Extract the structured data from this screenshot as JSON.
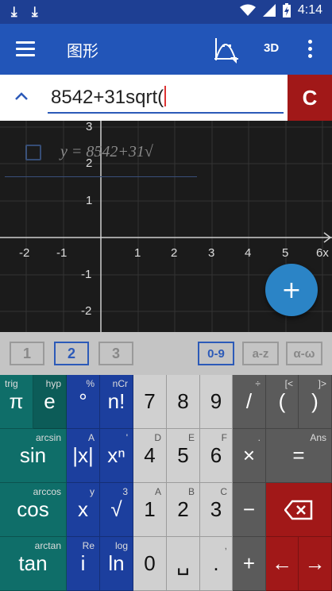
{
  "status_bar": {
    "time": "4:14"
  },
  "app_bar": {
    "title": "图形",
    "btn_3d": "3D"
  },
  "input": {
    "expression": "8542+31sqrt(",
    "clear_label": "C"
  },
  "graph": {
    "x_ticks": [
      "-2",
      "-1",
      "1",
      "2",
      "3",
      "4",
      "5",
      "6x"
    ],
    "y_ticks": [
      "3",
      "2",
      "1",
      "-1",
      "-2"
    ],
    "formula": "y = 8542+31√"
  },
  "keyboard_tabs": [
    "1",
    "2",
    "3",
    "0-9",
    "a-z",
    "α-ω"
  ],
  "keys": [
    {
      "main": "π",
      "sup": "trig"
    },
    {
      "main": "e",
      "sup": "hyp"
    },
    {
      "main": "°",
      "sup": "%"
    },
    {
      "main": "n!",
      "sup": "nCr"
    },
    {
      "main": "7",
      "sup": ""
    },
    {
      "main": "8",
      "sup": ""
    },
    {
      "main": "9",
      "sup": ""
    },
    {
      "main": "/",
      "sup": "÷"
    },
    {
      "main": "(",
      "sup": "[<"
    },
    {
      "main": ")",
      "sup": "]>"
    },
    {
      "main": "sin",
      "sup": "arcsin"
    },
    {
      "main": "|x|",
      "sup": "A"
    },
    {
      "main": "xⁿ",
      "sup": "'"
    },
    {
      "main": "4",
      "sup": "D"
    },
    {
      "main": "5",
      "sup": "E"
    },
    {
      "main": "6",
      "sup": "F"
    },
    {
      "main": "×",
      "sup": "."
    },
    {
      "main": "=",
      "sup": "Ans"
    },
    {
      "main": "cos",
      "sup": "arccos"
    },
    {
      "main": "x",
      "sup": "y"
    },
    {
      "main": "√",
      "sup": "3"
    },
    {
      "main": "1",
      "sup": "A"
    },
    {
      "main": "2",
      "sup": "B"
    },
    {
      "main": "3",
      "sup": "C"
    },
    {
      "main": "−",
      "sup": ""
    },
    {
      "main": "tan",
      "sup": "arctan"
    },
    {
      "main": "i",
      "sup": "Re"
    },
    {
      "main": "ln",
      "sup": "log"
    },
    {
      "main": "0",
      "sup": ""
    },
    {
      "main": "␣",
      "sup": ""
    },
    {
      "main": ".",
      "sup": ","
    },
    {
      "main": "+",
      "sup": ""
    },
    {
      "main": "←",
      "sup": ""
    },
    {
      "main": "→",
      "sup": ""
    }
  ],
  "colors": {
    "primary": "#2255b8",
    "accent_red": "#a11818",
    "teal": "#0f6e69"
  }
}
